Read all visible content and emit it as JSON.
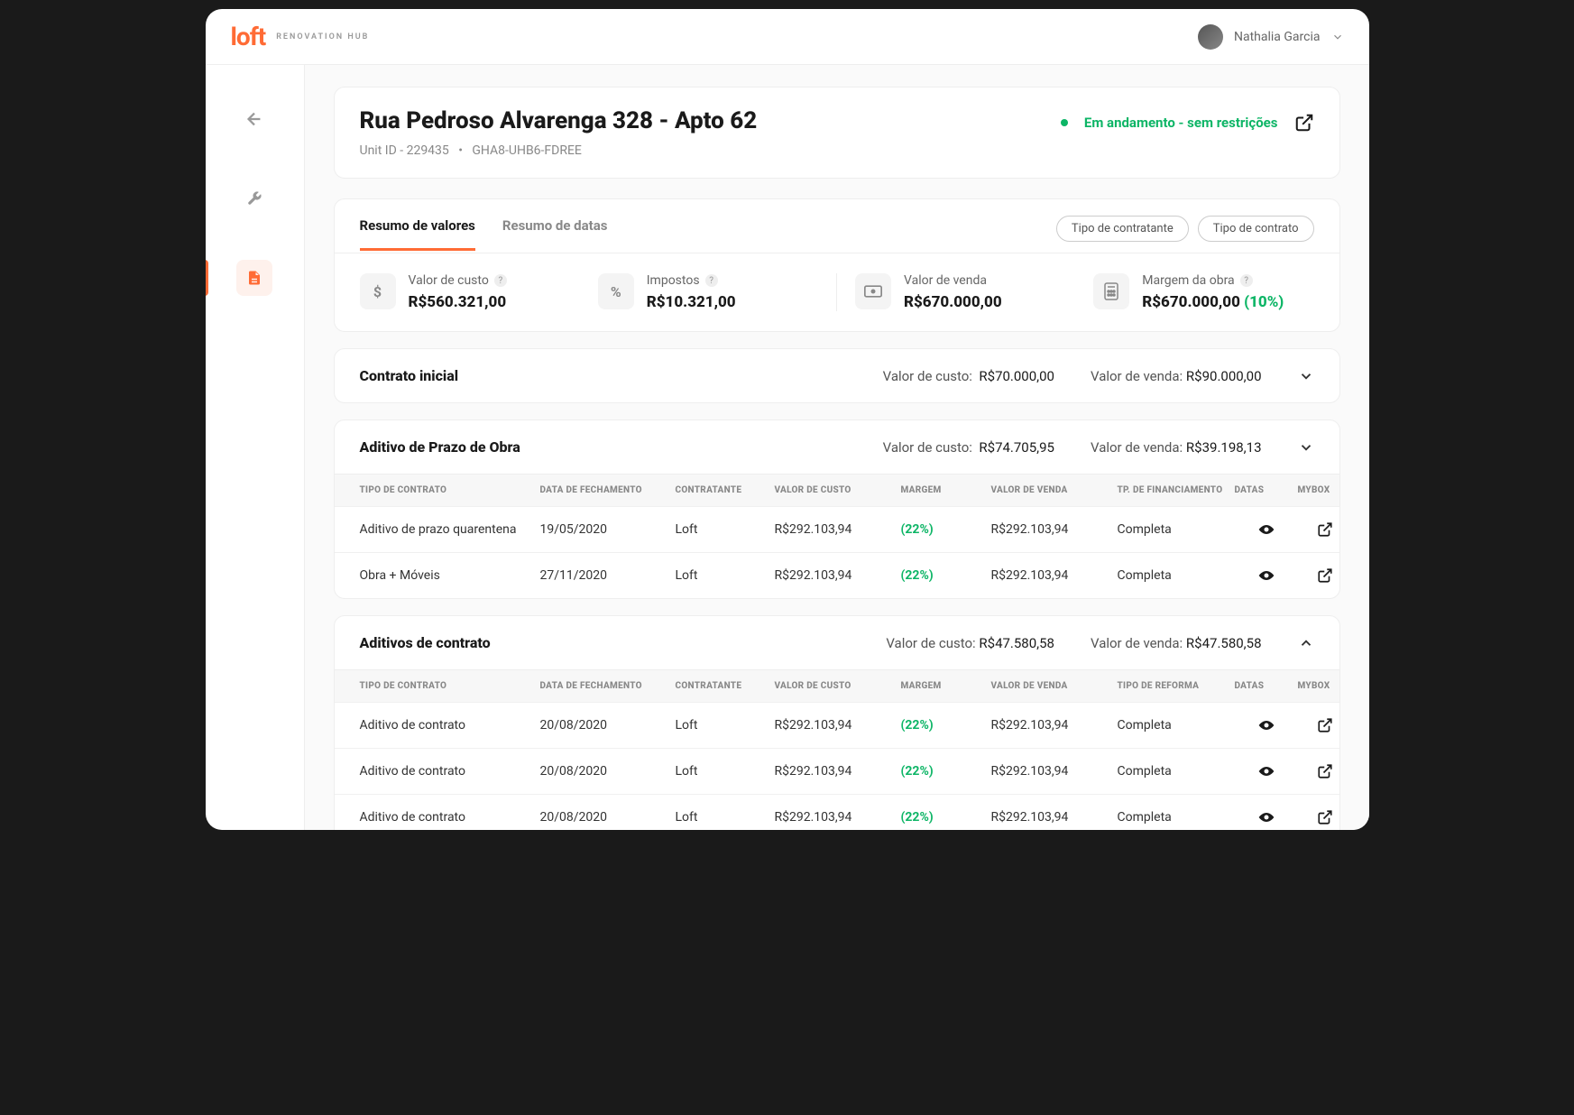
{
  "header": {
    "logo": "loft",
    "logo_sub": "RENOVATION HUB",
    "user_name": "Nathalia Garcia"
  },
  "page": {
    "title": "Rua Pedroso Alvarenga 328 - Apto 62",
    "unit_id_label": "Unit ID - 229435",
    "separator": "•",
    "code": "GHA8-UHB6-FDREE",
    "status": "Em andamento - sem restrições"
  },
  "tabs": {
    "t1": "Resumo de valores",
    "t2": "Resumo de datas",
    "pill1": "Tipo de contratante",
    "pill2": "Tipo de contrato"
  },
  "metrics": {
    "m1_lbl": "Valor de custo",
    "m1_val": "R$560.321,00",
    "m2_lbl": "Impostos",
    "m2_val": "R$10.321,00",
    "m3_lbl": "Valor de venda",
    "m3_val": "R$670.000,00",
    "m4_lbl": "Margem da obra",
    "m4_val": "R$670.000,00",
    "m4_pct": "(10%)"
  },
  "section1": {
    "title": "Contrato inicial",
    "cost_lbl": "Valor de custo:",
    "cost_val": "R$70.000,00",
    "sale_lbl": "Valor de venda:",
    "sale_val": "R$90.000,00"
  },
  "section2": {
    "title": "Aditivo de Prazo de Obra",
    "cost_lbl": "Valor de custo:",
    "cost_val": "R$74.705,95",
    "sale_lbl": "Valor de venda:",
    "sale_val": "R$39.198,13",
    "cols": {
      "c1": "TIPO DE CONTRATO",
      "c2": "DATA DE FECHAMENTO",
      "c3": "CONTRATANTE",
      "c4": "VALOR DE CUSTO",
      "c5": "MARGEM",
      "c6": "VALOR DE VENDA",
      "c7": "TP. DE FINANCIAMENTO",
      "c8": "DATAS",
      "c9": "MYBOX"
    },
    "rows": [
      {
        "tipo": "Aditivo de prazo quarentena",
        "data": "19/05/2020",
        "contratante": "Loft",
        "custo": "R$292.103,94",
        "margem": "(22%)",
        "venda": "R$292.103,94",
        "fin": "Completa"
      },
      {
        "tipo": "Obra + Móveis",
        "data": "27/11/2020",
        "contratante": "Loft",
        "custo": "R$292.103,94",
        "margem": "(22%)",
        "venda": "R$292.103,94",
        "fin": "Completa"
      }
    ]
  },
  "section3": {
    "title": "Aditivos de contrato",
    "cost_lbl": "Valor de custo:",
    "cost_val": "R$47.580,58",
    "sale_lbl": "Valor de venda:",
    "sale_val": "R$47.580,58",
    "cols": {
      "c1": "TIPO DE CONTRATO",
      "c2": "DATA DE FECHAMENTO",
      "c3": "CONTRATANTE",
      "c4": "VALOR DE CUSTO",
      "c5": "MARGEM",
      "c6": "VALOR DE VENDA",
      "c7": "TIPO DE REFORMA",
      "c8": "DATAS",
      "c9": "MYBOX"
    },
    "rows": [
      {
        "tipo": "Aditivo de contrato",
        "data": "20/08/2020",
        "contratante": "Loft",
        "custo": "R$292.103,94",
        "margem": "(22%)",
        "venda": "R$292.103,94",
        "fin": "Completa"
      },
      {
        "tipo": "Aditivo de contrato",
        "data": "20/08/2020",
        "contratante": "Loft",
        "custo": "R$292.103,94",
        "margem": "(22%)",
        "venda": "R$292.103,94",
        "fin": "Completa"
      },
      {
        "tipo": "Aditivo de contrato",
        "data": "20/08/2020",
        "contratante": "Loft",
        "custo": "R$292.103,94",
        "margem": "(22%)",
        "venda": "R$292.103,94",
        "fin": "Completa"
      }
    ]
  }
}
